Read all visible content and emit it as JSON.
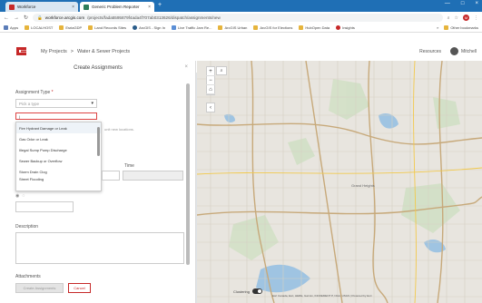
{
  "browser": {
    "tabs": [
      {
        "title": "Workforce",
        "close": "×"
      },
      {
        "title": "Generic Problem Reporter",
        "close": "×"
      }
    ],
    "new_tab": "+",
    "window_controls": [
      "—",
      "□",
      "×"
    ],
    "url_domain": "workforce.arcgis.com",
    "url_path": "/projects/fada5595879f4ada4f707ab0313626/dispatch/assignments/new",
    "bookmarks": [
      "Apps",
      "LOCALHOST",
      "EsriaGDP",
      "Land Records Sites",
      "ArcGIS - Sign In",
      "Live Traffic Jam Re...",
      "ArcGIS Urban",
      "ArcGIS for Elections",
      "HubOpen Data",
      "Insights"
    ],
    "bookmarks_right": [
      "»",
      "Other bookmarks"
    ],
    "avatar_letter": "M"
  },
  "app": {
    "breadcrumb": [
      "My Projects",
      ">",
      "Water & Sewer Projects"
    ],
    "resources": "Resources",
    "user": "Mitchell"
  },
  "panel": {
    "title": "Create Assignments",
    "close": "×",
    "assignment_type_label": "Assignment Type",
    "required_mark": "*",
    "select_placeholder": "Pick a type",
    "filter_value": "|",
    "dropdown_items": [
      "Fire Hydrant Damage or Leak",
      "Gas Odor or Leak",
      "Illegal Sump Pump Discharge",
      "Sewer Backup or Overflow",
      "Storm Drain Clog",
      "Street Flooding"
    ],
    "hint": "unit new locations.",
    "time_label": "Time",
    "description_label": "Description",
    "attachments_label": "Attachments",
    "create_button": "Create Assignments",
    "cancel_button": "Cancel"
  },
  "map": {
    "zoom_in": "+",
    "zoom_out": "−",
    "home": "⌂",
    "search_icon": "⌕",
    "collapse": "‹",
    "clustering_label": "Clustering",
    "clustering_on": true,
    "attribution": "Esri Canada, Esri, HERE, Garmin, INCREMENT P, NGA, USGS | Powered by Esri",
    "labels": [
      "Grand Heights"
    ]
  },
  "colors": {
    "tabbar": "#1f6fb5",
    "accent_red": "#c62828",
    "map_bg": "#e8e5df",
    "water": "#9fc4e2",
    "roads": "#c7a97a"
  }
}
